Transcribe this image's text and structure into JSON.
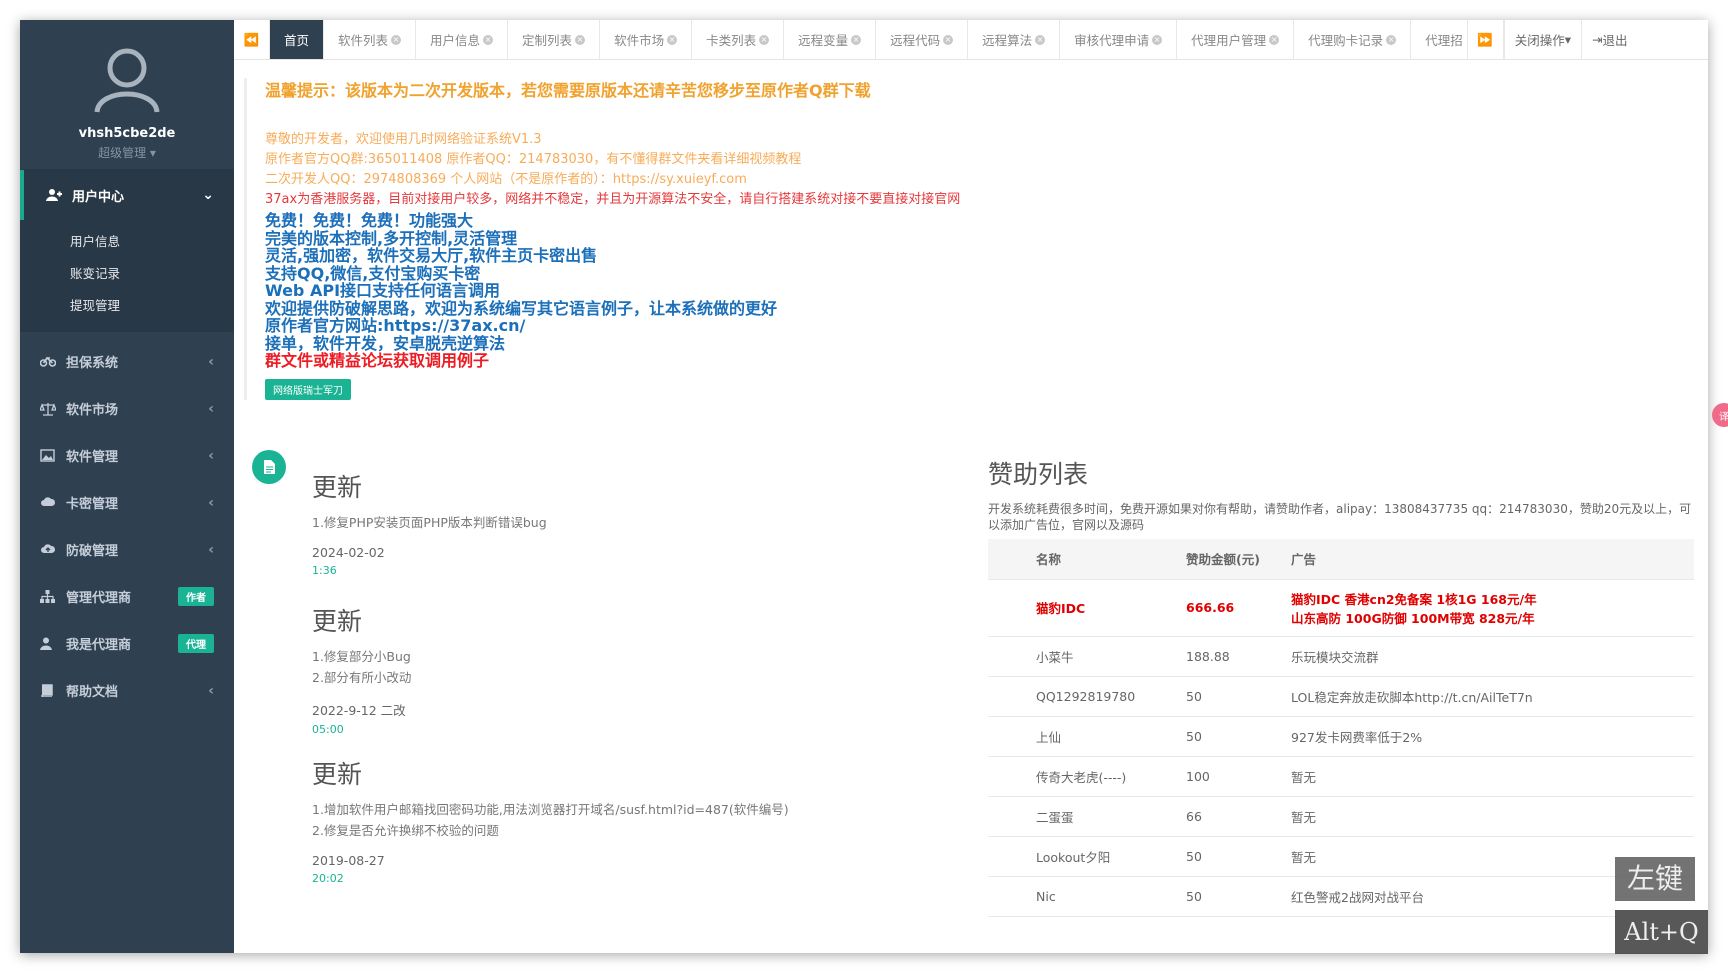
{
  "sidebar": {
    "username": "vhsh5cbe2de",
    "role": "超级管理",
    "top_menu": "用户中心",
    "subitems": [
      "用户信息",
      "账变记录",
      "提现管理"
    ],
    "items": [
      {
        "label": "担保系统",
        "icon": "motorcycle-icon"
      },
      {
        "label": "软件市场",
        "icon": "balance-scale-icon"
      },
      {
        "label": "软件管理",
        "icon": "image-icon"
      },
      {
        "label": "卡密管理",
        "icon": "cloud-icon"
      },
      {
        "label": "防破管理",
        "icon": "cloud-upload-icon"
      },
      {
        "label": "管理代理商",
        "badge": "作者",
        "icon": "sitemap-icon"
      },
      {
        "label": "我是代理商",
        "badge": "代理",
        "icon": "user-icon"
      },
      {
        "label": "帮助文档",
        "icon": "book-icon"
      }
    ]
  },
  "tabs": {
    "items": [
      "首页",
      "软件列表",
      "用户信息",
      "定制列表",
      "软件市场",
      "卡类列表",
      "远程变量",
      "远程代码",
      "远程算法",
      "审核代理申请",
      "代理用户管理",
      "代理购卡记录",
      "代理招"
    ],
    "close_ops": "关闭操作",
    "logout": "退出"
  },
  "notice": {
    "title": "温馨提示：该版本为二次开发版本，若您需要原版本还请辛苦您移步至原作者Q群下载",
    "orange_lines": [
      "尊敬的开发者，欢迎使用几时网络验证系统V1.3",
      "原作者官方QQ群:365011408 原作者QQ：214783030，有不懂得群文件夹看详细视频教程",
      "二次开发人QQ：2974808369 个人网站（不是原作者的）：https://sy.xuieyf.com"
    ],
    "red_line": "37ax为香港服务器，目前对接用户较多，网络并不稳定，并且为开源算法不安全，请自行搭建系统对接不要直接对接官网",
    "blue_lines": [
      "免费！免费！免费！功能强大",
      "完美的版本控制,多开控制,灵活管理",
      "灵活,强加密，软件交易大厅,软件主页卡密出售",
      "支持QQ,微信,支付宝购买卡密",
      "Web API接口支持任何语言调用",
      "欢迎提供防破解思路，欢迎为系统编写其它语言例子，让本系统做的更好",
      "原作者官方网站:https://37ax.cn/",
      "接单，软件开发，安卓脱壳逆算法"
    ],
    "big_red": "群文件或精益论坛获取调用例子",
    "button": "网络版瑞士军刀"
  },
  "timeline": [
    {
      "title": "更新",
      "lines": [
        "1.修复PHP安装页面PHP版本判断错误bug"
      ],
      "date": "2024-02-02",
      "time": "1:36"
    },
    {
      "title": "更新",
      "lines": [
        "1.修复部分小Bug",
        "2.部分有所小改动"
      ],
      "date": "2022-9-12 二改",
      "time": "05:00"
    },
    {
      "title": "更新",
      "lines": [
        "1.增加软件用户邮箱找回密码功能,用法浏览器打开域名/susf.html?id=487(软件编号)",
        "2.修复是否允许换绑不校验的问题"
      ],
      "date": "2019-08-27",
      "time": "20:02"
    }
  ],
  "sponsor": {
    "title": "赞助列表",
    "desc": "开发系统耗费很多时间，免费开源如果对你有帮助，请赞助作者，alipay：13808437735 qq：214783030，赞助20元及以上，可以添加广告位，官网以及源码",
    "headers": [
      "名称",
      "赞助金额(元)",
      "广告"
    ],
    "rows": [
      {
        "name": "猫豹IDC",
        "amount": "666.66",
        "ad": "猫豹IDC 香港cn2免备案 1核1G 168元/年",
        "ad2": "山东高防 100G防御 100M带宽 828元/年"
      },
      {
        "name": "小菜牛",
        "amount": "188.88",
        "ad": "乐玩模块交流群"
      },
      {
        "name": "QQ1292819780",
        "amount": "50",
        "ad": "LOL稳定奔放走砍脚本http://t.cn/AilTeT7n"
      },
      {
        "name": "上仙",
        "amount": "50",
        "ad": "927发卡网费率低于2%"
      },
      {
        "name": "传奇大老虎(----)",
        "amount": "100",
        "ad": "暂无"
      },
      {
        "name": "二蛋蛋",
        "amount": "66",
        "ad": "暂无"
      },
      {
        "name": "Lookout夕阳",
        "amount": "50",
        "ad": "暂无"
      },
      {
        "name": "Nic",
        "amount": "50",
        "ad": "红色警戒2战网对战平台"
      }
    ]
  },
  "overlay": {
    "key1": "左键",
    "key2": "Alt+Q",
    "float_btn": "译"
  }
}
